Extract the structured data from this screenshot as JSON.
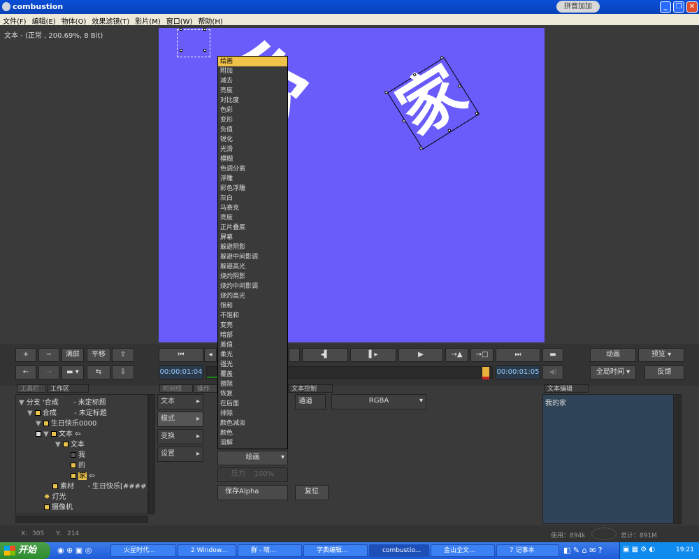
{
  "window": {
    "title": "combustion",
    "ime_label": "拼音加加"
  },
  "menu": [
    "文件(F)",
    "编辑(E)",
    "物体(O)",
    "效果滤镜(T)",
    "影片(M)",
    "窗口(W)",
    "帮助(H)"
  ],
  "layer_info": "文本 - (正常   , 200.69%, 8 Bit)",
  "canvas": {
    "glyph_left": "你",
    "glyph_right": "家",
    "bg_color": "#6a5cfb"
  },
  "controls": {
    "add": "+",
    "remove": "−",
    "fullscreen": "满屏",
    "pan": "平移",
    "timecode_left": "00:00:01:04",
    "timecode_right": "00:00:01:05",
    "animate": "动画",
    "preview": "预览",
    "global_time": "全局时间",
    "feedback": "反馈"
  },
  "tabs": {
    "toolbox": "工具栏",
    "workspace": "工作区",
    "timeline": "时间线",
    "operate": "操作",
    "text_control": "文本控制",
    "text_edit": "文本编辑"
  },
  "tree": [
    {
      "label": "分支  '合成",
      "note": "- 未定标题"
    },
    {
      "label": "合成",
      "note": "- 未定标题"
    },
    {
      "label": "生日快乐0000",
      "note": ""
    },
    {
      "label": "文本",
      "note": ""
    },
    {
      "label": "文本",
      "note": ""
    },
    {
      "label": "我",
      "note": ""
    },
    {
      "label": "的",
      "note": ""
    },
    {
      "label": "家",
      "note": ""
    },
    {
      "label": "素材",
      "note": "- 生日快乐[####]"
    },
    {
      "label": "灯光",
      "note": ""
    },
    {
      "label": "摄像机",
      "note": ""
    }
  ],
  "side_buttons": [
    "文本",
    "模式",
    "变换",
    "设置"
  ],
  "channel": {
    "label": "通道",
    "value": "RGBA"
  },
  "mode_select": "绘画",
  "pressure": {
    "label": "压力",
    "value": "100%"
  },
  "save_alpha": "保存Alpha",
  "reset": "复位",
  "blend_modes": [
    "绘画",
    "附加",
    "减去",
    "亮度",
    "对比度",
    "色彩",
    "变形",
    "负值",
    "锐化",
    "光滑",
    "模糊",
    "色调分离",
    "浮雕",
    "彩色浮雕",
    "灰白",
    "马赛克",
    "亮度",
    "正片叠底",
    "屏幕",
    "躲避阴影",
    "躲避中间影调",
    "躲避高光",
    "烧灼阴影",
    "烧灼中间影调",
    "烧灼高光",
    "饱和",
    "不饱和",
    "变亮",
    "暗部",
    "差值",
    "柔光",
    "强光",
    "覆盖",
    "擦除",
    "恢复",
    "在后面",
    "排除",
    "颜色减淡",
    "颜色",
    "溶解"
  ],
  "text_content": "我的家",
  "status": {
    "x_label": "X:",
    "x": "305",
    "y_label": "Y:",
    "y": "214",
    "used": "使用：894k",
    "total": "总计：891M"
  },
  "taskbar": {
    "start": "开始",
    "items": [
      "火星时代...",
      "2 Window...",
      "群 - 晴...",
      "字典编辑...",
      "combustio...",
      "金山全文...",
      "7 记事本"
    ],
    "clock": "19:21"
  }
}
